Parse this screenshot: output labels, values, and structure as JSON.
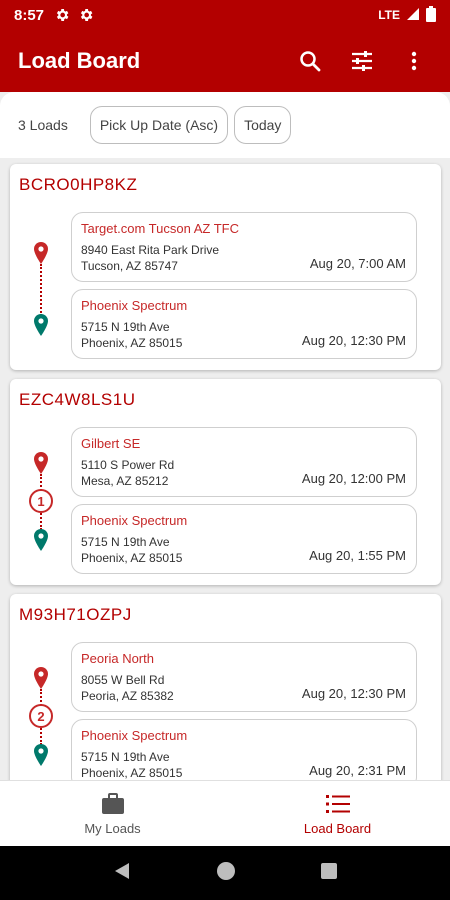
{
  "status_bar": {
    "time": "8:57",
    "network": "LTE"
  },
  "app_bar": {
    "title": "Load Board"
  },
  "filter_bar": {
    "count": "3 Loads",
    "sort_chip": "Pick Up Date (Asc)",
    "date_chip": "Today"
  },
  "loads": [
    {
      "id": "BCRO0HP8KZ",
      "stops_between": "",
      "pickup": {
        "name": "Target.com Tucson AZ TFC",
        "street": "8940 East Rita Park Drive",
        "city": "Tucson, AZ 85747",
        "time": "Aug 20, 7:00 AM"
      },
      "dropoff": {
        "name": "Phoenix Spectrum",
        "street": "5715 N 19th Ave",
        "city": "Phoenix, AZ 85015",
        "time": "Aug 20, 12:30 PM"
      }
    },
    {
      "id": "EZC4W8LS1U",
      "stops_between": "1",
      "pickup": {
        "name": "Gilbert SE",
        "street": "5110 S Power Rd",
        "city": "Mesa, AZ 85212",
        "time": "Aug 20, 12:00 PM"
      },
      "dropoff": {
        "name": "Phoenix Spectrum",
        "street": "5715 N 19th Ave",
        "city": "Phoenix, AZ 85015",
        "time": "Aug 20, 1:55 PM"
      }
    },
    {
      "id": "M93H71OZPJ",
      "stops_between": "2",
      "pickup": {
        "name": "Peoria North",
        "street": "8055 W Bell Rd",
        "city": "Peoria, AZ 85382",
        "time": "Aug 20, 12:30 PM"
      },
      "dropoff": {
        "name": "Phoenix Spectrum",
        "street": "5715 N 19th Ave",
        "city": "Phoenix, AZ 85015",
        "time": "Aug 20, 2:31 PM"
      }
    }
  ],
  "bottom_nav": {
    "my_loads": "My Loads",
    "load_board": "Load Board",
    "active": "load_board"
  },
  "colors": {
    "brand": "#b30000",
    "pickup_pin": "#c62828",
    "dropoff_pin": "#00796b"
  },
  "icons": [
    "settings-icon",
    "search-icon",
    "filter-sliders-icon",
    "more-vert-icon",
    "map-pin-icon",
    "briefcase-icon",
    "list-icon",
    "back-icon",
    "home-icon",
    "recents-icon"
  ]
}
